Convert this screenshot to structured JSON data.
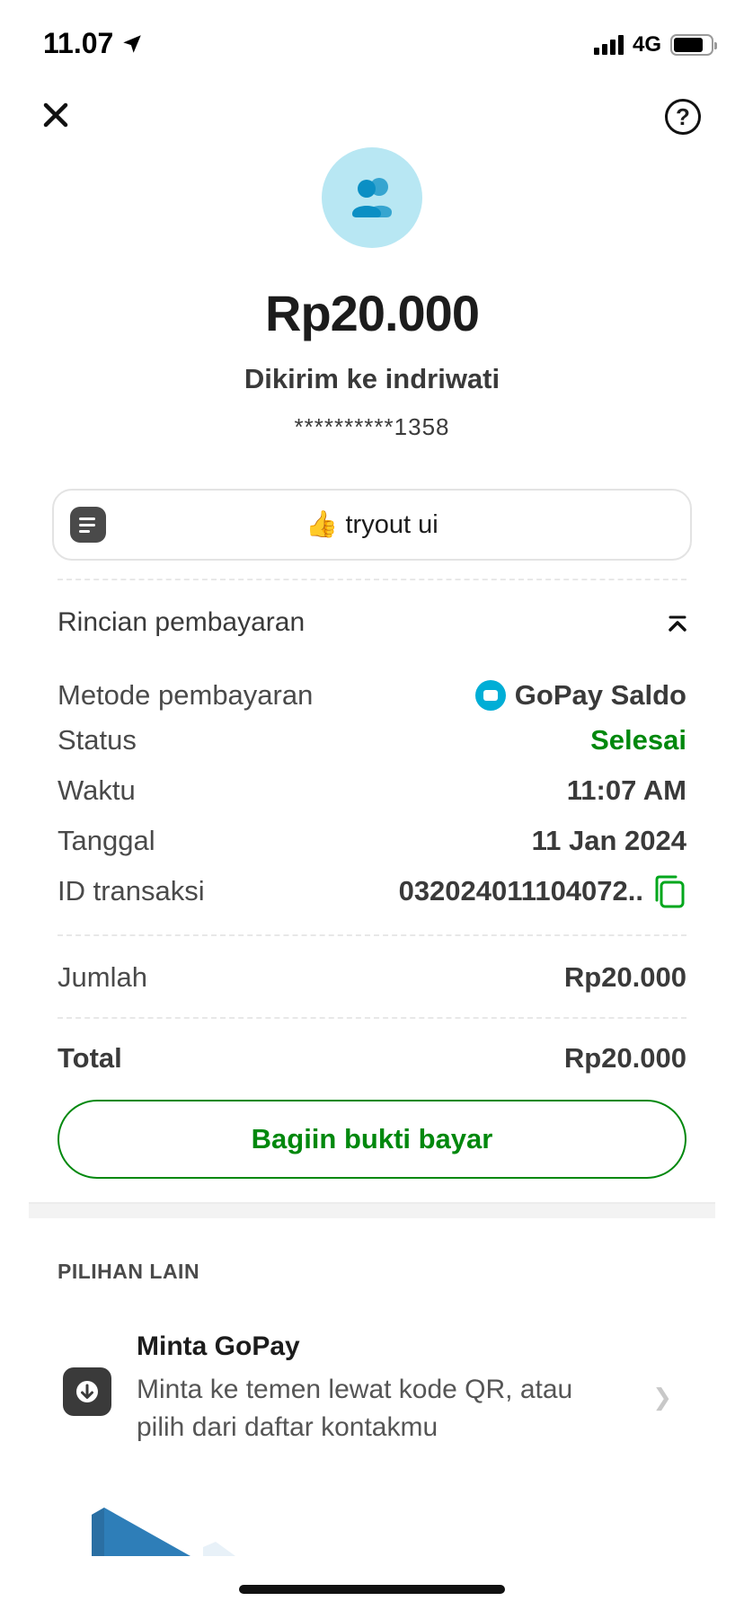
{
  "status_bar": {
    "time": "11.07",
    "network": "4G"
  },
  "header": {
    "amount": "Rp20.000",
    "recipient": "Dikirim ke indriwati",
    "account_masked": "**********1358"
  },
  "note": {
    "emoji": "👍",
    "text": "tryout ui"
  },
  "details": {
    "title": "Rincian pembayaran",
    "rows": [
      {
        "label": "Metode pembayaran",
        "value": "GoPay Saldo"
      },
      {
        "label": "Status",
        "value": "Selesai"
      },
      {
        "label": "Waktu",
        "value": "11:07 AM"
      },
      {
        "label": "Tanggal",
        "value": "11 Jan 2024"
      },
      {
        "label": "ID transaksi",
        "value": "032024011104072.."
      }
    ],
    "amount_label": "Jumlah",
    "amount_value": "Rp20.000",
    "total_label": "Total",
    "total_value": "Rp20.000"
  },
  "share_button": "Bagiin bukti bayar",
  "other": {
    "heading": "PILIHAN LAIN",
    "options": [
      {
        "title": "Minta GoPay",
        "description": "Minta ke temen lewat kode QR, atau pilih dari daftar kontakmu"
      }
    ]
  },
  "colors": {
    "success": "#00880d",
    "avatar_bg": "#b8e7f3",
    "gopay_blue": "#00aed6",
    "people_icon": "#0b8fc4"
  },
  "icons": [
    "location-arrow-icon",
    "close-icon",
    "help-icon",
    "people-icon",
    "note-icon",
    "collapse-chevron-icon",
    "gopay-wallet-icon",
    "copy-icon",
    "download-arrow-icon",
    "chevron-right-icon"
  ]
}
